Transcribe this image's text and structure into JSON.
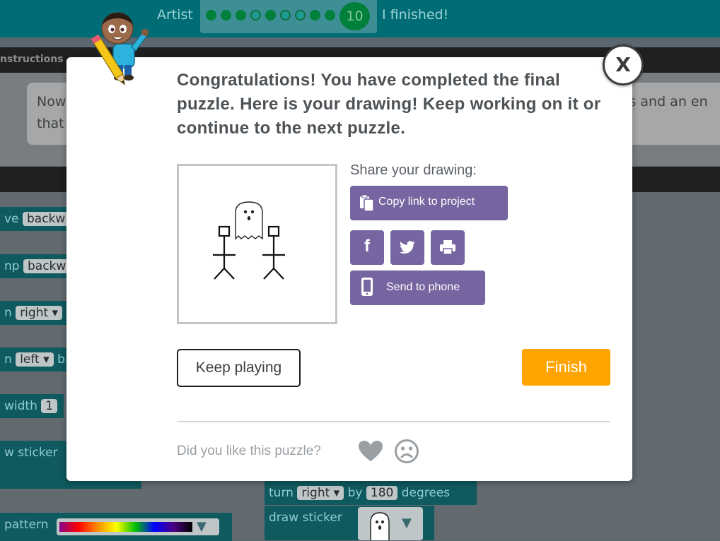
{
  "header": {
    "app_name": "Artist",
    "progress": {
      "dots": [
        "filled",
        "filled",
        "filled",
        "empty",
        "filled",
        "empty",
        "empty",
        "filled",
        "filled"
      ],
      "current_level": "10"
    },
    "status": "I finished!"
  },
  "instructions": {
    "tab_label": "nstructions",
    "line1": "Now",
    "line2": "that",
    "line1_end": "cks and an en"
  },
  "workspace": {
    "left_blocks": [
      {
        "prefix": "ve",
        "chip": "backw"
      },
      {
        "prefix": "np",
        "chip": "backwa"
      },
      {
        "prefix": "n",
        "chip": "right ▾"
      },
      {
        "prefix": "n",
        "chip": "left ▾",
        "suffix": "b"
      },
      {
        "prefix": "width",
        "chip": "1"
      },
      {
        "prefix": "w sticker"
      },
      {
        "prefix": "pattern"
      }
    ],
    "right_blocks": [
      {
        "prefix": "turn",
        "chip": "right ▾",
        "mid": "by",
        "chip2": "180",
        "suffix": "degrees"
      },
      {
        "prefix": "draw sticker"
      }
    ]
  },
  "modal": {
    "message": "Congratulations! You have completed the final puzzle. Here is your drawing! Keep working on it or continue to the next puzzle.",
    "share_label": "Share your drawing:",
    "copy_link_label": "Copy link to project",
    "send_phone_label": "Send to phone",
    "keep_playing_label": "Keep playing",
    "finish_label": "Finish",
    "feedback_question": "Did you like this puzzle?",
    "close_label": "X"
  },
  "colors": {
    "header_bg": "#006c75",
    "accent_purple": "#7665a0",
    "finish_orange": "#ffa400",
    "progress_green": "#00803a"
  }
}
